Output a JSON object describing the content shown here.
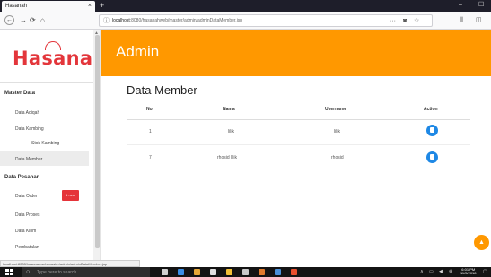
{
  "browser": {
    "tab_title": "Hasanah",
    "tab_close": "×",
    "new_tab": "+",
    "controls": {
      "minimize": "–",
      "maximize": "☐"
    },
    "url_host": "localhost",
    "url_rest": ":8080/hasanahweb/master/admin/adminDataMember.jsp",
    "more_icon": "···",
    "status_url": "localhost:8080/hasanahweb/master/admin/adminDataMember.jsp"
  },
  "sidebar": {
    "logo": "Hasanah",
    "sections": [
      {
        "title": "Master Data",
        "items": [
          "Data Aqiqah",
          "Data Kambing",
          "Stok Kambing",
          "Data Member"
        ]
      },
      {
        "title": "Data Pesanan",
        "items": [
          "Data Order",
          "Data Proses",
          "Data Kirim",
          "Pembatalan"
        ]
      }
    ],
    "order_badge": "1 new"
  },
  "header": {
    "title": "Admin"
  },
  "main": {
    "title": "Data Member",
    "table": {
      "columns": [
        "No.",
        "Nama",
        "Username",
        "Action"
      ],
      "rows": [
        {
          "no": "1",
          "nama": "lilik",
          "username": "lilik"
        },
        {
          "no": "7",
          "nama": "rhosid lilik",
          "username": "rhosid"
        }
      ]
    }
  },
  "taskbar": {
    "search_placeholder": "Type here to search",
    "time": "6:01 PM",
    "date": "11/5/2018"
  },
  "colors": {
    "accent": "#ff9800",
    "logo": "#e3363b",
    "action": "#1e88e5",
    "badge": "#e5343a"
  },
  "icons": [
    "back-icon",
    "forward-icon",
    "reload-icon",
    "home-icon",
    "info-icon",
    "bookmark-icon",
    "pocket-icon",
    "library-icon",
    "sidebar-icon",
    "delete-icon",
    "up-arrow-icon",
    "windows-start-icon",
    "search-icon"
  ]
}
